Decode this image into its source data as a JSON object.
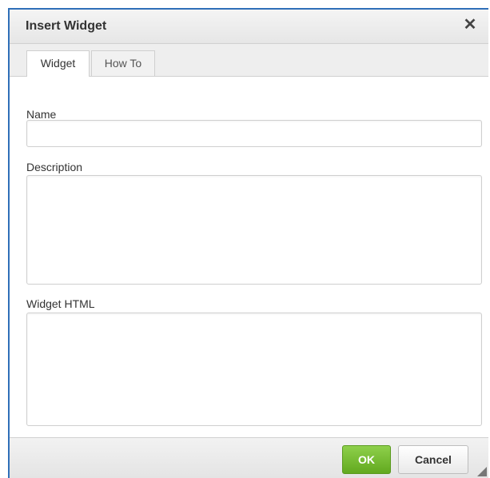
{
  "dialog": {
    "title": "Insert Widget",
    "close_icon": "close-icon"
  },
  "tabs": [
    {
      "label": "Widget",
      "active": true
    },
    {
      "label": "How To",
      "active": false
    }
  ],
  "form": {
    "name_label": "Name",
    "name_value": "",
    "description_label": "Description",
    "description_value": "",
    "html_label": "Widget HTML",
    "html_value": ""
  },
  "footer": {
    "ok_label": "OK",
    "cancel_label": "Cancel"
  },
  "colors": {
    "accent_border": "#2f6fb8",
    "ok_button": "#62a91f"
  }
}
